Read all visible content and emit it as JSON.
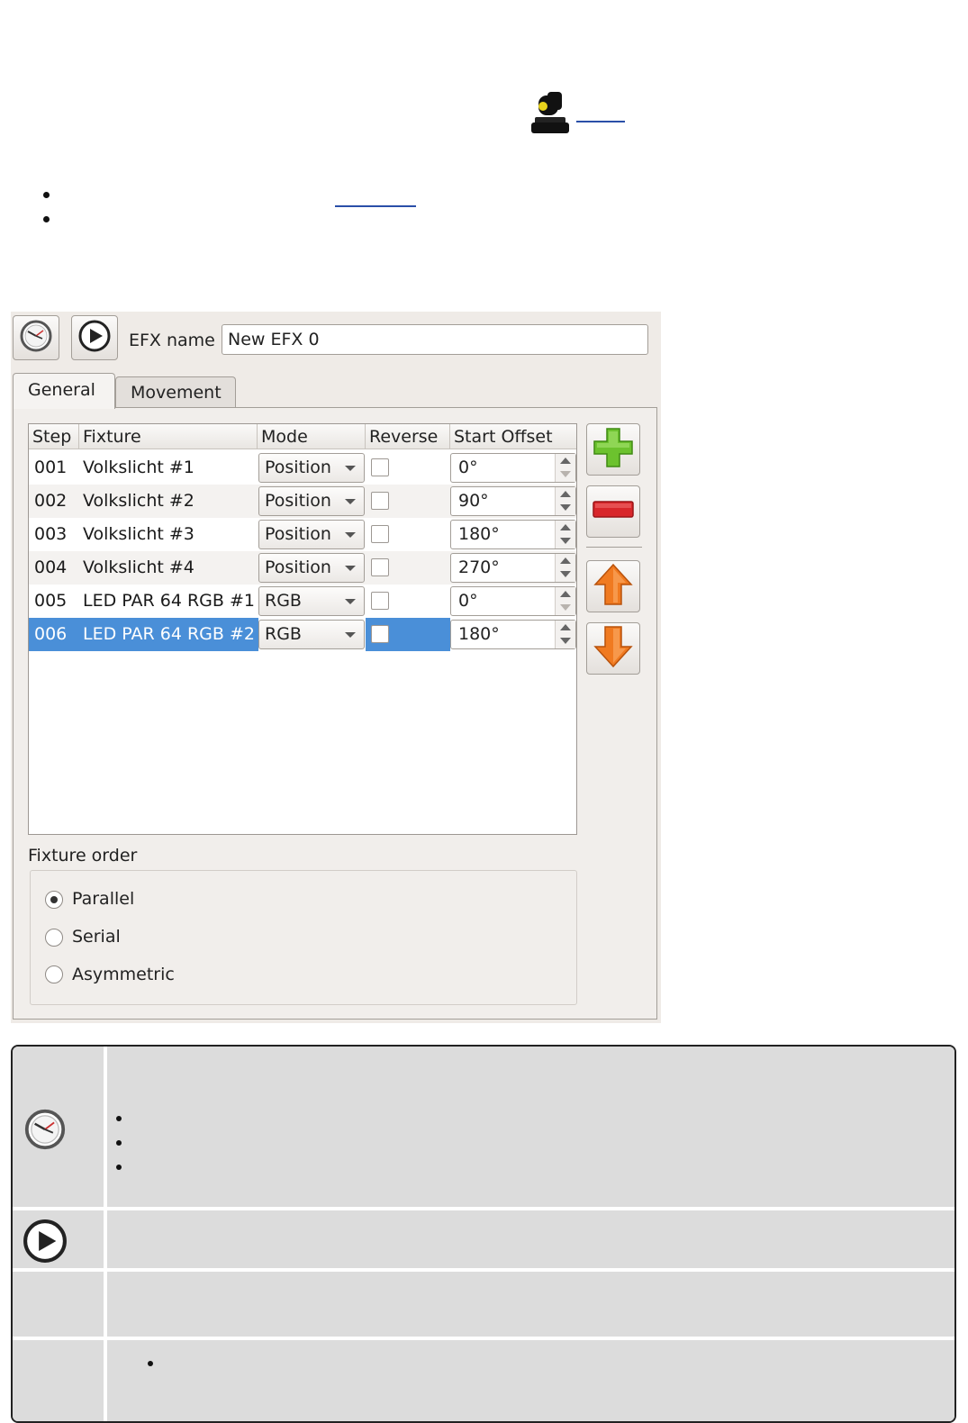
{
  "document": {
    "fixture_icon": "moving-head-fixture-icon",
    "link_text": "",
    "inline_link_text": ""
  },
  "toolbar": {
    "speed_icon": "clock-icon",
    "play_icon": "play-icon",
    "efx_name_label": "EFX name",
    "efx_name_value": "New EFX 0"
  },
  "tabs": [
    {
      "label": "General",
      "active": true
    },
    {
      "label": "Movement",
      "active": false
    }
  ],
  "fixture_table": {
    "headers": [
      "Step",
      "Fixture",
      "Mode",
      "Reverse",
      "Start Offset"
    ],
    "rows": [
      {
        "step": "001",
        "fixture": "Volkslicht #1",
        "mode": "Position",
        "reverse": false,
        "offset": "0°",
        "selected": false
      },
      {
        "step": "002",
        "fixture": "Volkslicht #2",
        "mode": "Position",
        "reverse": false,
        "offset": "90°",
        "selected": false
      },
      {
        "step": "003",
        "fixture": "Volkslicht #3",
        "mode": "Position",
        "reverse": false,
        "offset": "180°",
        "selected": false
      },
      {
        "step": "004",
        "fixture": "Volkslicht #4",
        "mode": "Position",
        "reverse": false,
        "offset": "270°",
        "selected": false
      },
      {
        "step": "005",
        "fixture": "LED PAR 64 RGB #1",
        "mode": "RGB",
        "reverse": false,
        "offset": "0°",
        "selected": false
      },
      {
        "step": "006",
        "fixture": "LED PAR 64 RGB #2",
        "mode": "RGB",
        "reverse": false,
        "offset": "180°",
        "selected": true
      }
    ]
  },
  "side_buttons": [
    "add-fixture-icon",
    "remove-fixture-icon",
    "raise-fixture-icon",
    "lower-fixture-icon"
  ],
  "fixture_order": {
    "label": "Fixture order",
    "options": [
      {
        "label": "Parallel",
        "checked": true
      },
      {
        "label": "Serial",
        "checked": false
      },
      {
        "label": "Asymmetric",
        "checked": false
      }
    ]
  },
  "colors": {
    "panel_bg": "#efebe7",
    "selection": "#4a8fd8",
    "add_green": "#6cc22e",
    "remove_red": "#d8262a",
    "arrow_orange": "#f07a20",
    "link_blue": "#2a4fa8"
  }
}
